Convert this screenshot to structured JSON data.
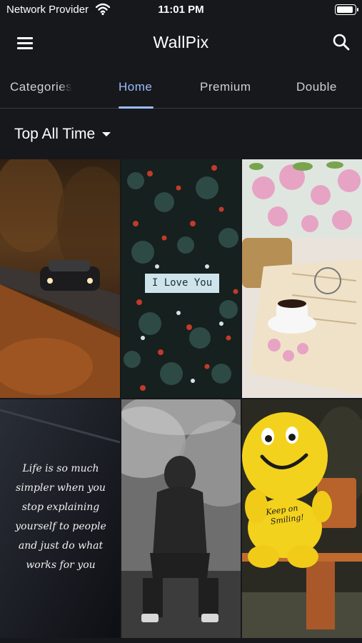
{
  "status_bar": {
    "carrier": "Network Provider",
    "time": "11:01 PM"
  },
  "app_bar": {
    "title": "WallPix"
  },
  "tabs": [
    {
      "label": "Categories",
      "active": false
    },
    {
      "label": "Home",
      "active": true
    },
    {
      "label": "Premium",
      "active": false
    },
    {
      "label": "Double",
      "active": false
    }
  ],
  "filter": {
    "label": "Top All Time"
  },
  "wallpapers": [
    {
      "subject": "car on autumn forest road"
    },
    {
      "subject": "flowers with sign",
      "overlay_text": "I Love You"
    },
    {
      "subject": "pink flowers and coffee cup on book"
    },
    {
      "subject": "handwritten quote",
      "overlay_text": "Life is so much simpler when you stop explaining yourself to people and just do what works for you"
    },
    {
      "subject": "hooded figure in smoke"
    },
    {
      "subject": "smiley plush toy on bench",
      "overlay_text": "Keep on Smiling!"
    }
  ],
  "colors": {
    "background": "#17181c",
    "accent": "#9bbcff",
    "text": "#ffffff"
  }
}
